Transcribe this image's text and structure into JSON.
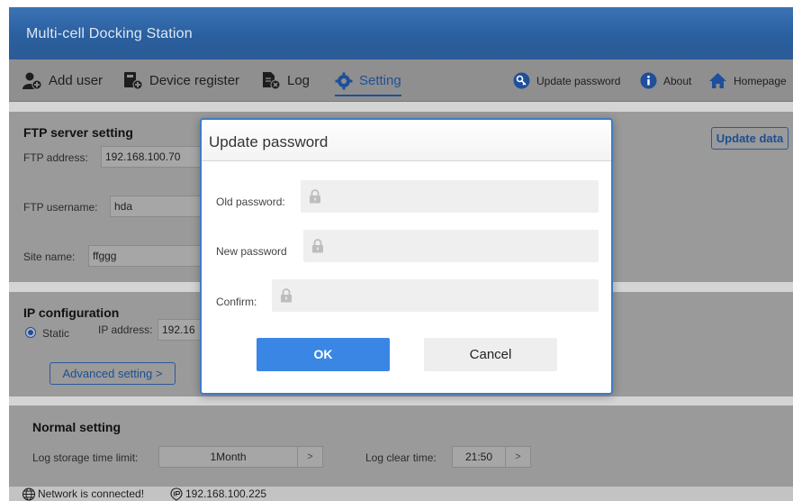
{
  "window": {
    "title": "Multi-cell Docking Station"
  },
  "toolbar": {
    "add_user": "Add user",
    "device_register": "Device register",
    "log": "Log",
    "setting": "Setting",
    "update_password": "Update password",
    "about": "About",
    "homepage": "Homepage"
  },
  "ftp": {
    "title": "FTP server setting",
    "address_label": "FTP address:",
    "address_value": "192.168.100.70",
    "username_label": "FTP username:",
    "username_value": "hda",
    "site_label": "Site name:",
    "site_value": "ffggg",
    "update_button": "Update data"
  },
  "ip": {
    "title": "IP configuration",
    "static_label": "Static",
    "address_label": "IP address:",
    "address_value": "192.16",
    "advanced_button": "Advanced setting >"
  },
  "normal": {
    "title": "Normal setting",
    "log_limit_label": "Log storage time limit:",
    "log_limit_value": "1Month",
    "log_clear_label": "Log clear time:",
    "log_clear_value": "21:50",
    "arrow": ">"
  },
  "status": {
    "network": "Network is connected!",
    "ip": "192.168.100.225"
  },
  "dialog": {
    "title": "Update password",
    "old_label": "Old password:",
    "new_label": "New password",
    "confirm_label": "Confirm:",
    "ok": "OK",
    "cancel": "Cancel"
  },
  "colors": {
    "accent": "#3a86e4",
    "dialog_border": "#3d7cc5",
    "titlebar": "#2a5f9f"
  }
}
